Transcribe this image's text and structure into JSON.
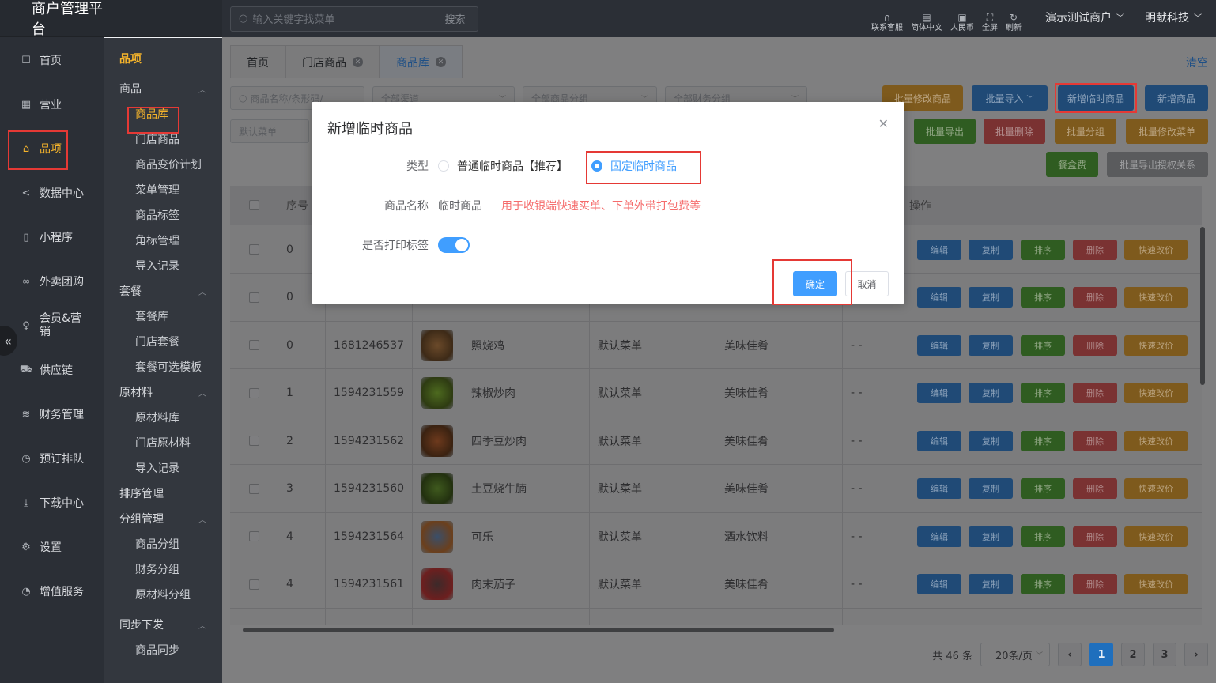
{
  "brand": "商户管理平台",
  "topbar": {
    "search_placeholder": "输入关键字找菜单",
    "search_btn": "搜索",
    "tools": [
      {
        "icon": "headset-icon",
        "label": "联系客服"
      },
      {
        "icon": "translate-icon",
        "label": "简体中文"
      },
      {
        "icon": "currency-icon",
        "label": "人民币"
      },
      {
        "icon": "fullscreen-icon",
        "label": "全屏"
      },
      {
        "icon": "refresh-icon",
        "label": "刷新"
      }
    ],
    "merchant": "演示测试商户",
    "company": "明献科技"
  },
  "nav": [
    {
      "icon": "home-icon",
      "label": "首页"
    },
    {
      "icon": "calendar-icon",
      "label": "营业"
    },
    {
      "icon": "bag-icon",
      "label": "品项"
    },
    {
      "icon": "share-icon",
      "label": "数据中心"
    },
    {
      "icon": "phone-icon",
      "label": "小程序"
    },
    {
      "icon": "bike-icon",
      "label": "外卖团购"
    },
    {
      "icon": "user-icon",
      "label": "会员&营销"
    },
    {
      "icon": "truck-icon",
      "label": "供应链"
    },
    {
      "icon": "database-icon",
      "label": "财务管理"
    },
    {
      "icon": "clock-icon",
      "label": "预订排队"
    },
    {
      "icon": "download-icon",
      "label": "下载中心"
    },
    {
      "icon": "gear-icon",
      "label": "设置"
    },
    {
      "icon": "alarm-icon",
      "label": "增值服务"
    }
  ],
  "subnav": {
    "title": "品项",
    "groups": [
      {
        "label": "商品",
        "items": [
          "商品库",
          "门店商品",
          "商品变价计划",
          "菜单管理",
          "商品标签",
          "角标管理",
          "导入记录"
        ]
      },
      {
        "label": "套餐",
        "items": [
          "套餐库",
          "门店套餐",
          "套餐可选模板"
        ]
      },
      {
        "label": "原材料",
        "items": [
          "原材料库",
          "门店原材料",
          "导入记录"
        ]
      },
      {
        "label": "排序管理",
        "items": []
      },
      {
        "label": "分组管理",
        "items": [
          "商品分组",
          "财务分组",
          "原材料分组"
        ]
      },
      {
        "label": "同步下发",
        "items": [
          "商品同步"
        ]
      }
    ]
  },
  "tabs": [
    {
      "label": "首页"
    },
    {
      "label": "门店商品"
    },
    {
      "label": "商品库"
    }
  ],
  "clear_label": "清空",
  "filters": {
    "code_placeholder": "商品名称/条形码/",
    "channel": "全部渠道",
    "goods_group": "全部商品分组",
    "finance_group": "全部财务分组",
    "menu": "默认菜单"
  },
  "actions": {
    "batch_edit": "批量修改商品",
    "batch_import": "批量导入",
    "add_temp": "新增临时商品",
    "add_goods": "新增商品",
    "batch_export": "批量导出",
    "batch_delete": "批量删除",
    "batch_group": "批量分组",
    "batch_menu": "批量修改菜单",
    "box_fee": "餐盒费",
    "export_auth": "批量导出授权关系"
  },
  "table": {
    "headers": {
      "seq": "序号",
      "ops": "操作"
    },
    "rows": [
      {
        "seq": "0",
        "code": "",
        "name": "",
        "menu": "",
        "group": "",
        "extra": ""
      },
      {
        "seq": "0",
        "code": "",
        "name": "",
        "menu": "",
        "group": "",
        "extra": ""
      },
      {
        "seq": "0",
        "code": "1681246537",
        "name": "照烧鸡",
        "menu": "默认菜单",
        "group": "美味佳肴",
        "extra": "- -"
      },
      {
        "seq": "1",
        "code": "1594231559",
        "name": "辣椒炒肉",
        "menu": "默认菜单",
        "group": "美味佳肴",
        "extra": "- -"
      },
      {
        "seq": "2",
        "code": "1594231562",
        "name": "四季豆炒肉",
        "menu": "默认菜单",
        "group": "美味佳肴",
        "extra": "- -"
      },
      {
        "seq": "3",
        "code": "1594231560",
        "name": "土豆烧牛腩",
        "menu": "默认菜单",
        "group": "美味佳肴",
        "extra": "- -"
      },
      {
        "seq": "4",
        "code": "1594231564",
        "name": "可乐",
        "menu": "默认菜单",
        "group": "酒水饮料",
        "extra": "- -"
      },
      {
        "seq": "4",
        "code": "1594231561",
        "name": "肉末茄子",
        "menu": "默认菜单",
        "group": "美味佳肴",
        "extra": "- -"
      }
    ],
    "op_labels": {
      "edit": "编辑",
      "copy": "复制",
      "sort": "排序",
      "delete": "删除",
      "quick_price": "快速改价"
    }
  },
  "pager": {
    "total": "共 46 条",
    "size": "20条/页",
    "pages": [
      "1",
      "2",
      "3"
    ],
    "current": "1"
  },
  "dialog": {
    "title": "新增临时商品",
    "type_label": "类型",
    "type_option_normal": "普通临时商品【推荐】",
    "type_option_fixed": "固定临时商品",
    "name_label": "商品名称",
    "name_value": "临时商品",
    "name_hint": "用于收银端快速买单、下单外带打包费等",
    "print_label": "是否打印标签",
    "print_enabled": true,
    "ok": "确定",
    "cancel": "取消"
  },
  "colors": {
    "primary": "#409eff",
    "highlight": "#e53935",
    "hint": "#f56c6c",
    "active_menu": "#f4b32b"
  }
}
